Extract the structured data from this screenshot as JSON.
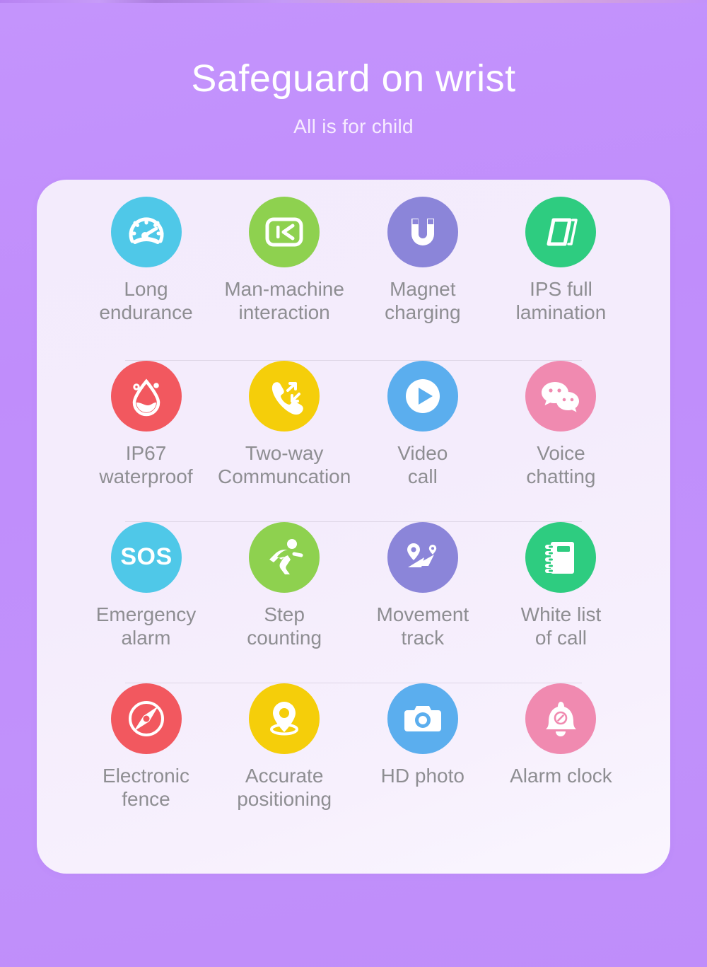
{
  "hero": {
    "title": "Safeguard on wrist",
    "subtitle": "All is for child"
  },
  "colors": {
    "background_top": "#c494fc",
    "background_bottom": "#bf8dfa",
    "card_background": "#f3ebfc",
    "label_text": "#8e8e92",
    "title_text": "#ffffff",
    "separator": "#ded6e6"
  },
  "features": {
    "rows": [
      {
        "separator": true,
        "cells": [
          {
            "label": "Long\nendurance",
            "icon": "speedometer-icon",
            "color": "#4fc8e8"
          },
          {
            "label": "Man-machine\ninteraction",
            "icon": "skip-back-screen-icon",
            "color": "#8ed14f"
          },
          {
            "label": "Magnet\ncharging",
            "icon": "magnet-icon",
            "color": "#8b85d9"
          },
          {
            "label": "IPS full\nlamination",
            "icon": "lamination-layers-icon",
            "color": "#2ecc80"
          }
        ]
      },
      {
        "separator": true,
        "cells": [
          {
            "label": "IP67\nwaterproof",
            "icon": "water-drop-icon",
            "color": "#f2585f"
          },
          {
            "label": "Two-way\nCommuncation",
            "icon": "phone-two-way-icon",
            "color": "#f5ce0a"
          },
          {
            "label": "Video\ncall",
            "icon": "play-circle-icon",
            "color": "#5baeee"
          },
          {
            "label": "Voice\nchatting",
            "icon": "chat-bubbles-icon",
            "color": "#f08ab0"
          }
        ]
      },
      {
        "separator": true,
        "cells": [
          {
            "label": "Emergency\nalarm",
            "icon": "sos-icon",
            "color": "#4fc8e8"
          },
          {
            "label": "Step\ncounting",
            "icon": "running-person-icon",
            "color": "#8ed14f"
          },
          {
            "label": "Movement\ntrack",
            "icon": "map-route-icon",
            "color": "#8b85d9"
          },
          {
            "label": "White list\nof call",
            "icon": "notebook-icon",
            "color": "#2ecc80"
          }
        ]
      },
      {
        "separator": false,
        "cells": [
          {
            "label": "Electronic\nfence",
            "icon": "compass-icon",
            "color": "#f2585f"
          },
          {
            "label": "Accurate\npositioning",
            "icon": "location-pin-icon",
            "color": "#f5ce0a"
          },
          {
            "label": "HD photo",
            "icon": "camera-icon",
            "color": "#5baeee"
          },
          {
            "label": "Alarm clock",
            "icon": "alarm-bell-icon",
            "color": "#f08ab0"
          }
        ]
      }
    ]
  }
}
